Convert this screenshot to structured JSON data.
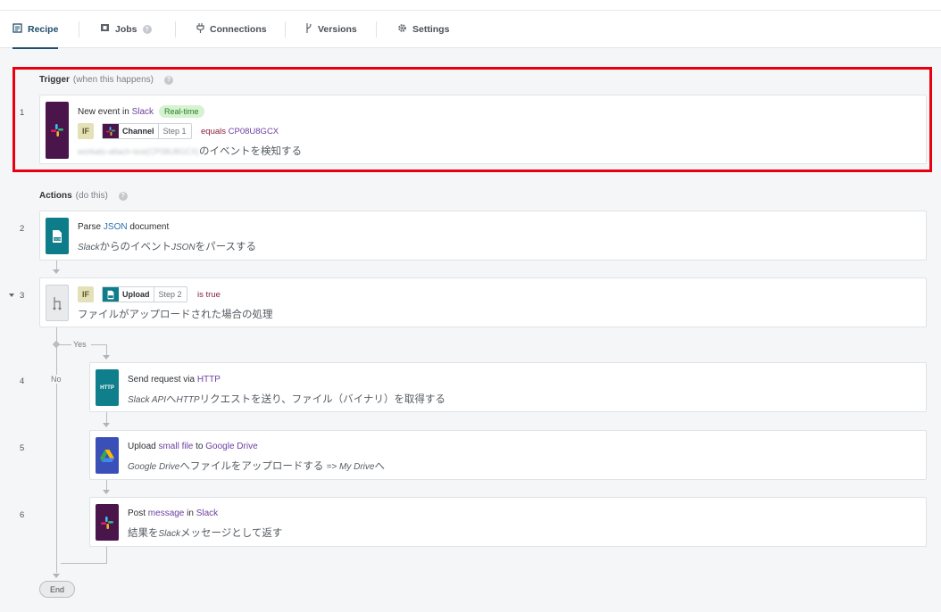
{
  "tabs": [
    {
      "label": "Recipe",
      "icon": "document-icon",
      "active": true
    },
    {
      "label": "Jobs",
      "icon": "flag-icon",
      "help": "?"
    },
    {
      "label": "Connections",
      "icon": "plug-icon"
    },
    {
      "label": "Versions",
      "icon": "branch-icon"
    },
    {
      "label": "Settings",
      "icon": "gear-icon"
    }
  ],
  "trigger": {
    "title": "Trigger",
    "subtitle": "(when this happens)",
    "help": "?"
  },
  "actions_header": {
    "title": "Actions",
    "subtitle": "(do this)",
    "help": "?"
  },
  "steps": {
    "s1": {
      "num": "1",
      "title_pre": "New event in ",
      "title_app": "Slack",
      "badge": "Real-time",
      "if_label": "IF",
      "pill_name": "Channel",
      "pill_step": "Step 1",
      "cond_op": "equals ",
      "cond_val": "CP08U8GCX",
      "desc_blur": "workato-attach-test(CP08U8GCX)",
      "desc": "のイベントを検知する"
    },
    "s2": {
      "num": "2",
      "title_pre": "Parse ",
      "title_hl": "JSON",
      "title_post": " document",
      "desc_it": "Slack",
      "desc_a": "からのイベント",
      "desc_it2": "JSON",
      "desc_b": "をパースする"
    },
    "s3": {
      "num": "3",
      "if_label": "IF",
      "pill_name": "Upload",
      "pill_step": "Step 2",
      "cond": "is true",
      "desc": "ファイルがアップロードされた場合の処理",
      "yes": "Yes",
      "no": "No"
    },
    "s4": {
      "num": "4",
      "title_pre": "Send request via ",
      "title_hl": "HTTP",
      "icon_text": "HTTP",
      "desc_it": "Slack API",
      "desc_a": "へ",
      "desc_it2": "HTTP",
      "desc_b": "リクエストを送り、ファイル（バイナリ）を取得する"
    },
    "s5": {
      "num": "5",
      "title_pre": "Upload ",
      "title_hl": "small file",
      "title_mid": " to ",
      "title_app": "Google Drive",
      "desc_it": "Google Drive",
      "desc_a": "へファイルをアップロードする ",
      "desc_it2": "=> My Drive",
      "desc_b": "へ"
    },
    "s6": {
      "num": "6",
      "title_pre": "Post ",
      "title_hl": "message",
      "title_mid": " in ",
      "title_app": "Slack",
      "desc_a": "結果を",
      "desc_it": "Slack",
      "desc_b": "メッセージとして返す"
    }
  },
  "end_label": "End",
  "colors": {
    "accent": "#1f4f6b",
    "highlight_border": "#e60012",
    "slack": "#4a154b",
    "json": "#0e7d8a",
    "gdrive": "#3b4fb8"
  }
}
